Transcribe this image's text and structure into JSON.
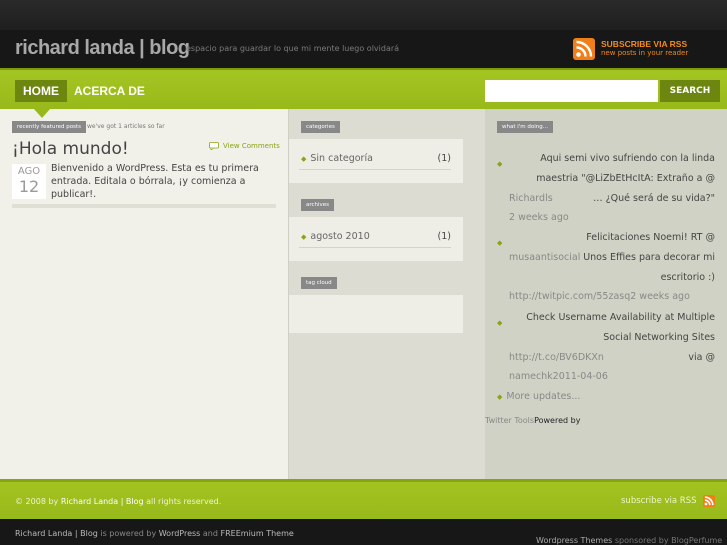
{
  "header": {
    "site_title": "richard landa | blog",
    "tagline": "espacio para guardar lo que mi mente luego olvidará",
    "rss_title": "SUBSCRIBE VIA RSS",
    "rss_subtitle": "new posts in your reader"
  },
  "nav": {
    "home": "HOME",
    "about": "ACERCA DE",
    "search_value": "",
    "search_button": "SEARCH"
  },
  "featured": {
    "pill": "recently featured posts",
    "note": "we've got 1 articles so far"
  },
  "post": {
    "title": "¡Hola mundo!",
    "view_comments": "View Comments",
    "date_month": "AGO",
    "date_day": "12",
    "body": "Bienvenido a WordPress. Esta es tu primera entrada. Editala o bórrala, ¡y comienza a publicar!."
  },
  "widgets": {
    "categories": {
      "pill": "categories",
      "items": [
        {
          "label": "Sin categoría",
          "count": "(1)"
        }
      ]
    },
    "archives": {
      "pill": "archives",
      "items": [
        {
          "label": "agosto 2010",
          "count": "(1)"
        }
      ]
    },
    "tag_cloud": {
      "pill": "tag cloud"
    }
  },
  "status": {
    "pill": "what i'm doing...",
    "tweets": [
      {
        "lines": [
          {
            "a": "Aqui semi vivo sufriendo con la linda",
            "b": ""
          },
          {
            "a": "maestria \"@LiZbEtHcItA: Extraño a @",
            "b": ""
          },
          {
            "a": "Richardls",
            "b": "… ¿Qué será de su vida?\""
          },
          {
            "a": "2 weeks ago",
            "b": ""
          }
        ]
      },
      {
        "lines": [
          {
            "a": "Felicitaciones Noemi! RT @",
            "b": ""
          },
          {
            "a": "musaantisocial",
            "b": "Unos Effies para decorar mi"
          },
          {
            "a": "escritorio :)",
            "b": ""
          },
          {
            "a": "http://twitpic.com/55zasq2 weeks ago",
            "b": ""
          }
        ]
      },
      {
        "lines": [
          {
            "a": "Check Username Availability at Multiple",
            "b": ""
          },
          {
            "a": "Social Networking Sites",
            "b": ""
          },
          {
            "a": "http://t.co/BV6DKXn",
            "b": "via @"
          },
          {
            "a": "namechk2011-04-06",
            "b": ""
          }
        ]
      }
    ],
    "more_updates": "More updates...",
    "twitter_tools": "Twitter Tools",
    "powered_by": "Powered by"
  },
  "footer": {
    "copy_prefix": "© 2008 by",
    "copy_name": "Richard Landa | Blog",
    "copy_suffix": "all rights reserved.",
    "subscribe": "subscribe via RSS"
  },
  "bottom": {
    "left_name": "Richard Landa | Blog",
    "left_is": "is powered by",
    "left_wp": "WordPress",
    "left_and": "and",
    "left_theme": "FREEmium Theme",
    "right_wt": "Wordpress Themes",
    "right_sp": "sponsored by",
    "right_bp": "BlogPerfume"
  },
  "colors": {
    "accent_green": "#98b91a",
    "dark_green": "#6d8610",
    "rss_orange": "#f07f1a"
  }
}
